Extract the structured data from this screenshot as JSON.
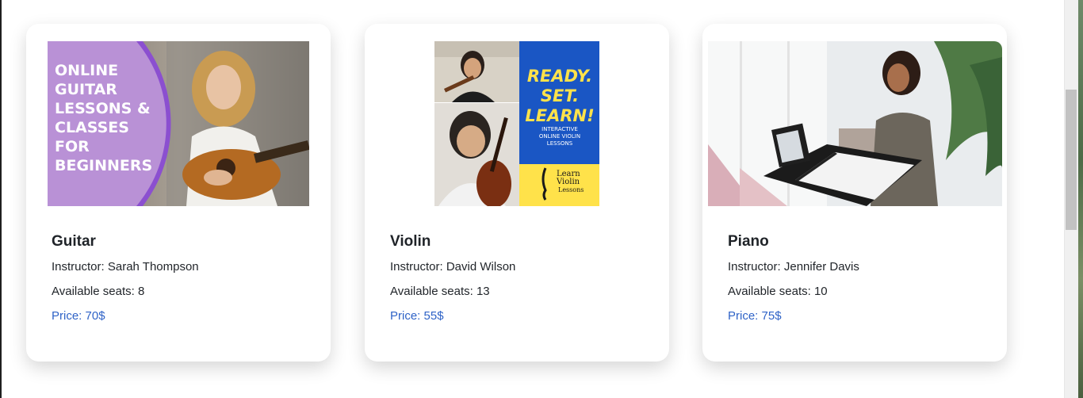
{
  "courses": [
    {
      "name": "Guitar",
      "instructor": "Instructor: Sarah Thompson",
      "seats": "Available seats: 8",
      "price": "Price: 70$",
      "image_text": [
        "ONLINE",
        "GUITAR",
        "LESSONS &",
        "CLASSES",
        "FOR",
        "BEGINNERS"
      ]
    },
    {
      "name": "Violin",
      "instructor": "Instructor: David Wilson",
      "seats": "Available seats: 13",
      "price": "Price: 55$",
      "image_text": {
        "headline": [
          "READY.",
          "SET.",
          "LEARN!"
        ],
        "sub": [
          "INTERACTIVE",
          "ONLINE VIOLIN",
          "LESSONS"
        ],
        "logo": [
          "Learn",
          "Violin",
          "Lessons"
        ]
      }
    },
    {
      "name": "Piano",
      "instructor": "Instructor: Jennifer Davis",
      "seats": "Available seats: 10",
      "price": "Price: 75$"
    }
  ],
  "colors": {
    "price": "#2f63c7",
    "title": "#1f2328",
    "guitar_panel": "#b991d6",
    "violin_panel": "#1a56c4",
    "violin_yellow": "#ffe24a"
  }
}
